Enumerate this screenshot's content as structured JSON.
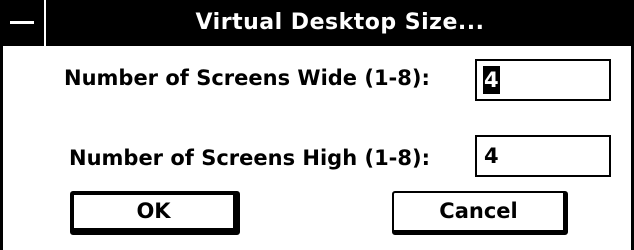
{
  "window": {
    "title": "Virtual Desktop Size..."
  },
  "fields": {
    "wide": {
      "label": "Number of Screens Wide (1-8):",
      "value": "4"
    },
    "high": {
      "label": "Number of Screens High (1-8):",
      "value": "4"
    }
  },
  "buttons": {
    "ok_label": "OK",
    "cancel_label": "Cancel"
  }
}
